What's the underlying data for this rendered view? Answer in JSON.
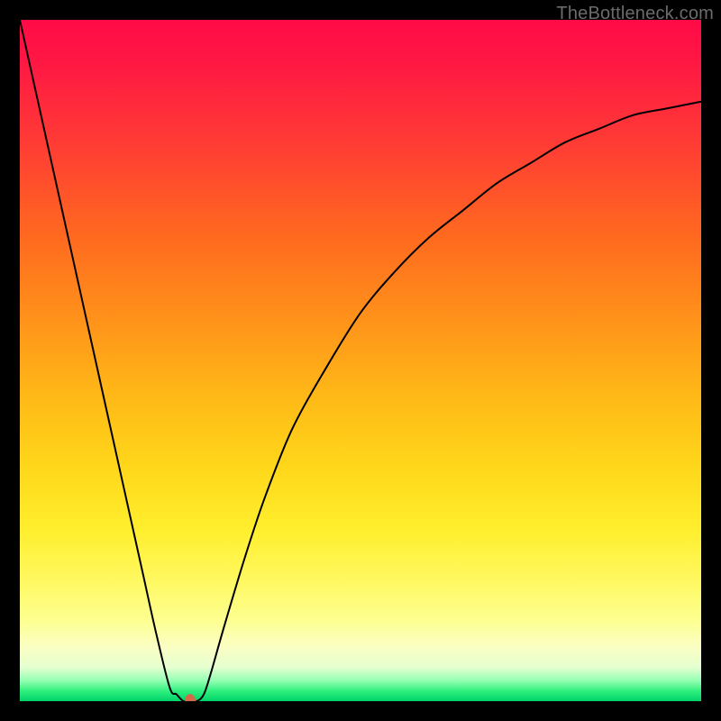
{
  "watermark": {
    "text": "TheBottleneck.com"
  },
  "chart_data": {
    "type": "line",
    "title": "",
    "xlabel": "",
    "ylabel": "",
    "xlim": [
      0,
      100
    ],
    "ylim": [
      0,
      100
    ],
    "grid": false,
    "legend": false,
    "series": [
      {
        "name": "bottleneck-curve",
        "x": [
          0,
          2,
          4,
          6,
          8,
          10,
          12,
          14,
          16,
          18,
          20,
          22,
          23,
          24,
          25,
          26,
          27,
          28,
          30,
          33,
          36,
          40,
          45,
          50,
          55,
          60,
          65,
          70,
          75,
          80,
          85,
          90,
          95,
          100
        ],
        "values": [
          100,
          91,
          82,
          73,
          64,
          55,
          46,
          37,
          28,
          19,
          10,
          2,
          1,
          0,
          0,
          0,
          1,
          4,
          11,
          21,
          30,
          40,
          49,
          57,
          63,
          68,
          72,
          76,
          79,
          82,
          84,
          86,
          87,
          88
        ]
      }
    ],
    "marker": {
      "name": "optimum-point",
      "x": 25,
      "y": 0,
      "color": "#d46a4a",
      "rx": 6,
      "ry": 8
    },
    "background": {
      "type": "vertical-gradient",
      "stops": [
        {
          "pos": 0.0,
          "color": "#ff0b46"
        },
        {
          "pos": 0.3,
          "color": "#ff6a1f"
        },
        {
          "pos": 0.6,
          "color": "#ffd81a"
        },
        {
          "pos": 0.85,
          "color": "#fdff8f"
        },
        {
          "pos": 1.0,
          "color": "#00d36a"
        }
      ]
    }
  }
}
